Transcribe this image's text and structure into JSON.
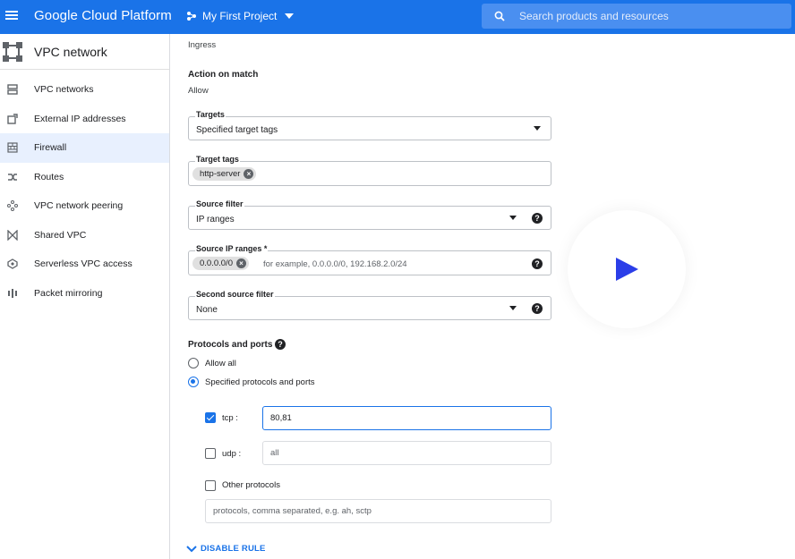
{
  "header": {
    "brand": "Google Cloud Platform",
    "project": "My First Project",
    "search_placeholder": "Search products and resources",
    "accent": "#1a73e8"
  },
  "sidebar": {
    "title": "VPC network",
    "items": [
      {
        "label": "VPC networks",
        "icon": "vpc-networks-icon"
      },
      {
        "label": "External IP addresses",
        "icon": "external-ip-icon"
      },
      {
        "label": "Firewall",
        "icon": "firewall-icon",
        "active": true
      },
      {
        "label": "Routes",
        "icon": "routes-icon"
      },
      {
        "label": "VPC network peering",
        "icon": "peering-icon"
      },
      {
        "label": "Shared VPC",
        "icon": "shared-vpc-icon"
      },
      {
        "label": "Serverless VPC access",
        "icon": "serverless-icon"
      },
      {
        "label": "Packet mirroring",
        "icon": "packet-mirroring-icon"
      }
    ]
  },
  "form": {
    "direction_value": "Ingress",
    "action_label": "Action on match",
    "action_value": "Allow",
    "targets": {
      "label": "Targets",
      "value": "Specified target tags"
    },
    "target_tags": {
      "label": "Target tags",
      "chip": "http-server"
    },
    "source_filter": {
      "label": "Source filter",
      "value": "IP ranges"
    },
    "source_ip_ranges": {
      "label": "Source IP ranges *",
      "chip": "0.0.0.0/0",
      "placeholder": "for example, 0.0.0.0/0, 192.168.2.0/24"
    },
    "second_source_filter": {
      "label": "Second source filter",
      "value": "None"
    },
    "protocols": {
      "label": "Protocols and ports",
      "allow_all": "Allow all",
      "specified": "Specified protocols and ports",
      "selected": "specified",
      "tcp": {
        "label": "tcp :",
        "checked": true,
        "value": "80,81"
      },
      "udp": {
        "label": "udp :",
        "checked": false,
        "placeholder": "all"
      },
      "other": {
        "label": "Other protocols",
        "checked": false,
        "placeholder": "protocols, comma separated, e.g. ah, sctp"
      }
    },
    "disable_rule": "DISABLE RULE"
  }
}
